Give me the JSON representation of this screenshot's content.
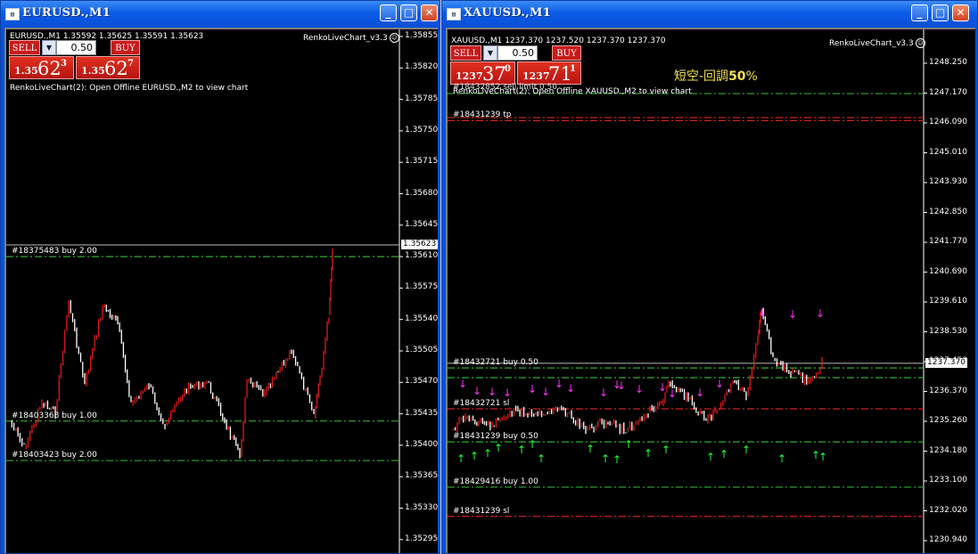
{
  "left": {
    "title": "EURUSD.,M1",
    "hud_info": "EURUSD.,M1  1.35592 1.35625 1.35591 1.35623",
    "indicator": "RenkoLiveChart_v3.3",
    "panel": {
      "sell": "SELL",
      "buy": "BUY",
      "lot": "0.50",
      "bid_small": "1.35",
      "bid_big": "62",
      "bid_sup": "3",
      "ask_small": "1.35",
      "ask_big": "62",
      "ask_sup": "7"
    },
    "comment": "RenkoLiveChart(2): Open Offline EURUSD.,M2 to view chart",
    "current_price": "1.35623",
    "yaxis": [
      "1.35855",
      "1.35820",
      "1.35785",
      "1.35750",
      "1.35715",
      "1.35680",
      "1.35645",
      "1.35610",
      "1.35575",
      "1.35540",
      "1.35505",
      "1.35470",
      "1.35435",
      "1.35400",
      "1.35365",
      "1.35330",
      "1.35295"
    ],
    "orders": [
      {
        "label": "#18375483 buy 2.00",
        "price": 1.3561,
        "color": "#2fae2f"
      },
      {
        "label": "#18403368 buy 1.00",
        "price": 1.35427,
        "color": "#2fae2f"
      },
      {
        "label": "#18403423 buy 2.00",
        "price": 1.35383,
        "color": "#2fae2f"
      }
    ]
  },
  "right": {
    "title": "XAUUSD.,M1",
    "hud_info": "XAUUSD.,M1  1237.370 1237.520 1237.370 1237.370",
    "indicator": "RenkoLiveChart_v3.3",
    "panel": {
      "sell": "SELL",
      "buy": "BUY",
      "lot": "0.50",
      "bid_small": "1237",
      "bid_big": "37",
      "bid_sup": "0",
      "ask_small": "1237",
      "ask_big": "71",
      "ask_sup": "1"
    },
    "comment": "RenkoLiveChart(2): Open Offline XAUUSD.,M2 to view chart",
    "overlay_comment": "#18432852 sell limit 0.50",
    "annotation_prefix": "短空-回調",
    "annotation_value": "50",
    "annotation_suffix": "%",
    "current_price": "1237.370",
    "yaxis": [
      "1248.250",
      "1247.170",
      "1246.090",
      "1245.010",
      "1243.930",
      "1242.850",
      "1241.770",
      "1240.690",
      "1239.610",
      "1238.530",
      "1237.450",
      "1236.370",
      "1235.260",
      "1234.180",
      "1233.100",
      "1232.020",
      "1230.940"
    ],
    "orders": [
      {
        "label": "#18431239 tp",
        "price": 1246.17,
        "color": "#d02020"
      },
      {
        "label": "#18432721 buy 0.50",
        "price": 1237.2,
        "color": "#2fae2f"
      },
      {
        "label": "#18432721 sl",
        "price": 1235.72,
        "color": "#d02020"
      },
      {
        "label": "#18431239 buy 0.50",
        "price": 1234.52,
        "color": "#2fae2f"
      },
      {
        "label": "#18429416 buy 1.00",
        "price": 1232.88,
        "color": "#2fae2f"
      },
      {
        "label": "#18431239 sl",
        "price": 1231.82,
        "color": "#d02020"
      }
    ],
    "extra_lines": [
      {
        "price": 1247.15,
        "color": "#2fae2f"
      },
      {
        "price": 1246.28,
        "color": "#d02020"
      },
      {
        "price": 1236.85,
        "color": "#2fae2f"
      }
    ]
  },
  "colors": {
    "bull": "#e01a1a",
    "bear": "#ffffff",
    "up_arrow": "#22ff33",
    "down_arrow": "#ff33ff"
  }
}
